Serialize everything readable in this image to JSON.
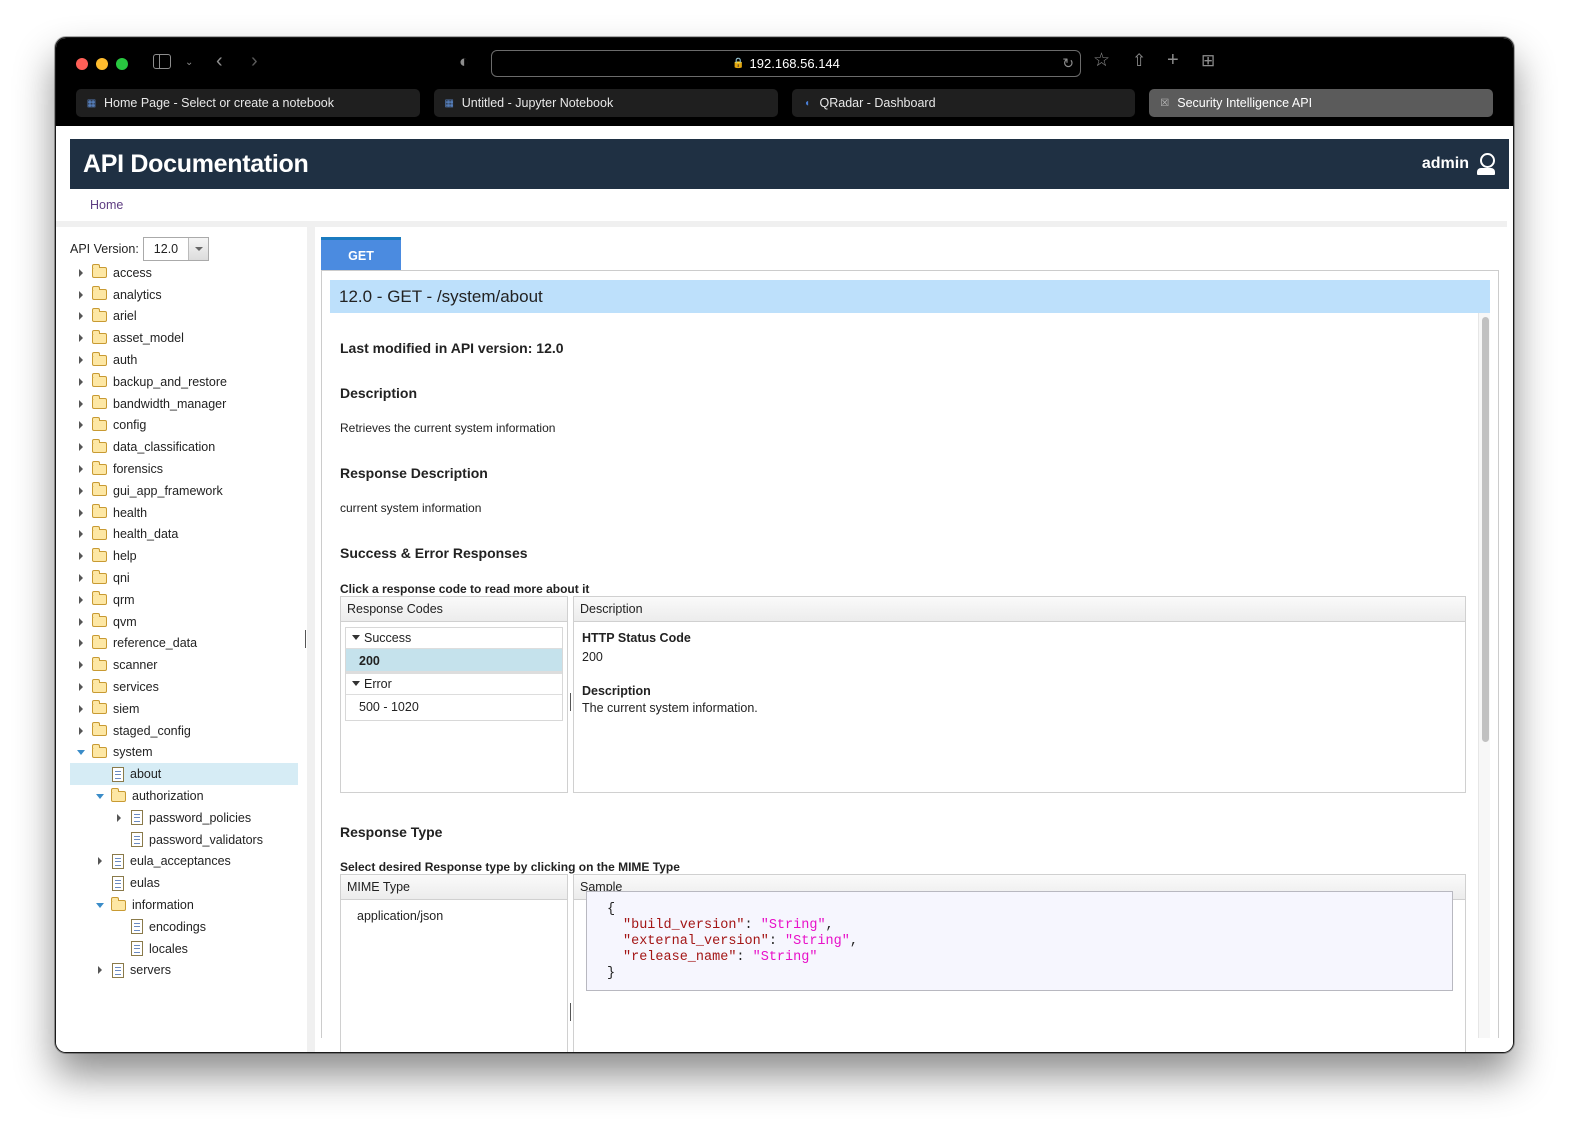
{
  "browser": {
    "address": "192.168.56.144",
    "tabs": [
      {
        "label": "Home Page - Select or create a notebook",
        "icon": "jupyter-icon",
        "active": false
      },
      {
        "label": "Untitled - Jupyter Notebook",
        "icon": "jupyter-icon",
        "active": false
      },
      {
        "label": "QRadar - Dashboard",
        "icon": "qradar-icon",
        "active": false
      },
      {
        "label": "Security Intelligence API",
        "icon": "api-icon",
        "active": true
      }
    ]
  },
  "header": {
    "title": "API Documentation",
    "user": "admin"
  },
  "breadcrumb": {
    "home": "Home"
  },
  "sidebar": {
    "version_label": "API Version:",
    "version_value": "12.0",
    "tree": [
      {
        "label": "access",
        "type": "folder",
        "level": 0,
        "state": "closed"
      },
      {
        "label": "analytics",
        "type": "folder",
        "level": 0,
        "state": "closed"
      },
      {
        "label": "ariel",
        "type": "folder",
        "level": 0,
        "state": "closed"
      },
      {
        "label": "asset_model",
        "type": "folder",
        "level": 0,
        "state": "closed"
      },
      {
        "label": "auth",
        "type": "folder",
        "level": 0,
        "state": "closed"
      },
      {
        "label": "backup_and_restore",
        "type": "folder",
        "level": 0,
        "state": "closed"
      },
      {
        "label": "bandwidth_manager",
        "type": "folder",
        "level": 0,
        "state": "closed"
      },
      {
        "label": "config",
        "type": "folder",
        "level": 0,
        "state": "closed"
      },
      {
        "label": "data_classification",
        "type": "folder",
        "level": 0,
        "state": "closed"
      },
      {
        "label": "forensics",
        "type": "folder",
        "level": 0,
        "state": "closed"
      },
      {
        "label": "gui_app_framework",
        "type": "folder",
        "level": 0,
        "state": "closed"
      },
      {
        "label": "health",
        "type": "folder",
        "level": 0,
        "state": "closed"
      },
      {
        "label": "health_data",
        "type": "folder",
        "level": 0,
        "state": "closed"
      },
      {
        "label": "help",
        "type": "folder",
        "level": 0,
        "state": "closed"
      },
      {
        "label": "qni",
        "type": "folder",
        "level": 0,
        "state": "closed"
      },
      {
        "label": "qrm",
        "type": "folder",
        "level": 0,
        "state": "closed"
      },
      {
        "label": "qvm",
        "type": "folder",
        "level": 0,
        "state": "closed"
      },
      {
        "label": "reference_data",
        "type": "folder",
        "level": 0,
        "state": "closed"
      },
      {
        "label": "scanner",
        "type": "folder",
        "level": 0,
        "state": "closed"
      },
      {
        "label": "services",
        "type": "folder",
        "level": 0,
        "state": "closed"
      },
      {
        "label": "siem",
        "type": "folder",
        "level": 0,
        "state": "closed"
      },
      {
        "label": "staged_config",
        "type": "folder",
        "level": 0,
        "state": "closed"
      },
      {
        "label": "system",
        "type": "folder",
        "level": 0,
        "state": "open"
      },
      {
        "label": "about",
        "type": "file",
        "level": 1,
        "state": "none",
        "selected": true
      },
      {
        "label": "authorization",
        "type": "folder",
        "level": 1,
        "state": "open"
      },
      {
        "label": "password_policies",
        "type": "file",
        "level": 2,
        "state": "closed"
      },
      {
        "label": "password_validators",
        "type": "file",
        "level": 2,
        "state": "none"
      },
      {
        "label": "eula_acceptances",
        "type": "file",
        "level": 1,
        "state": "closed"
      },
      {
        "label": "eulas",
        "type": "file",
        "level": 1,
        "state": "none"
      },
      {
        "label": "information",
        "type": "folder",
        "level": 1,
        "state": "open"
      },
      {
        "label": "encodings",
        "type": "file",
        "level": 2,
        "state": "none"
      },
      {
        "label": "locales",
        "type": "file",
        "level": 2,
        "state": "none"
      },
      {
        "label": "servers",
        "type": "file",
        "level": 1,
        "state": "closed"
      }
    ]
  },
  "main": {
    "method_tab": "GET",
    "endpoint_title": "12.0 - GET - /system/about",
    "last_modified": "Last modified in API version: 12.0",
    "description_heading": "Description",
    "description": "Retrieves the current system information",
    "response_description_heading": "Response Description",
    "response_description": "current system information",
    "responses_heading": "Success & Error Responses",
    "responses_hint": "Click a response code to read more about it",
    "codes_header": "Response Codes",
    "codes_desc_header": "Description",
    "code_groups": [
      {
        "label": "Success",
        "items": [
          {
            "code": "200",
            "selected": true
          }
        ]
      },
      {
        "label": "Error",
        "items": [
          {
            "code": "500 - 1020",
            "selected": false
          }
        ]
      }
    ],
    "selected_code": {
      "status_label": "HTTP Status Code",
      "status_value": "200",
      "desc_label": "Description",
      "desc_value": "The current system information."
    },
    "response_type_heading": "Response Type",
    "response_type_hint": "Select desired Response type by clicking on the MIME Type",
    "mime_header": "MIME Type",
    "sample_header": "Sample",
    "mime_types": [
      "application/json"
    ],
    "sample": {
      "open": "{",
      "close": "}",
      "fields": [
        {
          "key": "\"build_version\"",
          "value": "\"String\"",
          "sep": ","
        },
        {
          "key": "\"external_version\"",
          "value": "\"String\"",
          "sep": ","
        },
        {
          "key": "\"release_name\"",
          "value": "\"String\"",
          "sep": ""
        }
      ]
    }
  }
}
